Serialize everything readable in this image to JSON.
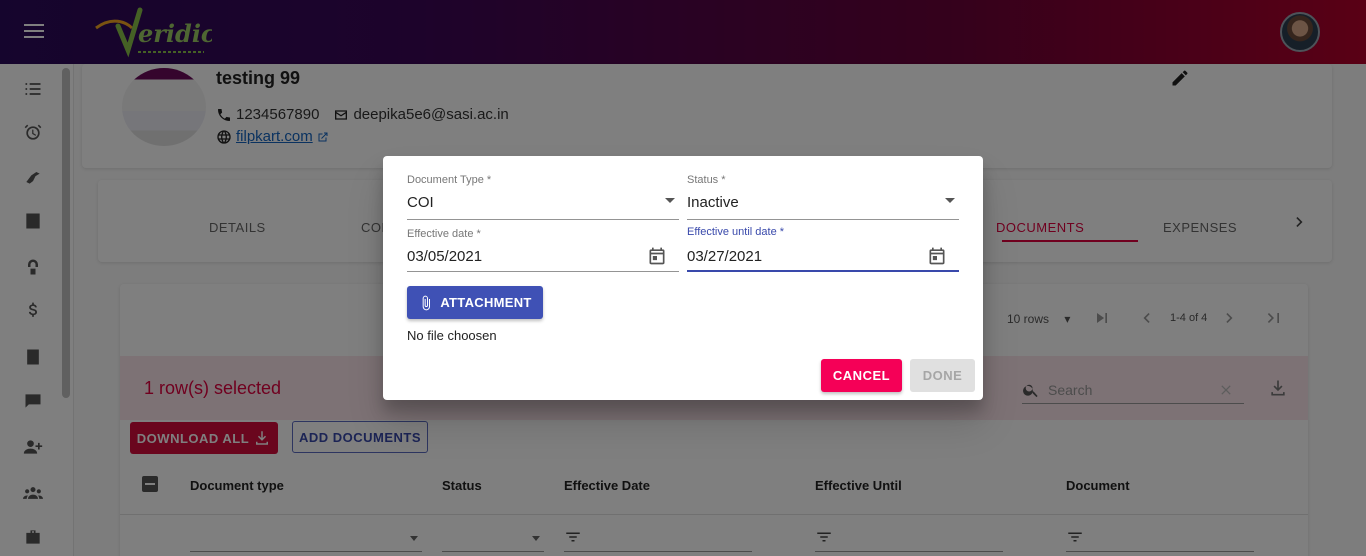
{
  "app": {
    "logo_text": "Veridic"
  },
  "profile": {
    "name": "testing 99",
    "phone": "1234567890",
    "email": "deepika5e6@sasi.ac.in",
    "website": "filpkart.com"
  },
  "tabs": {
    "details": "DETAILS",
    "partial": "CON",
    "documents": "DOCUMENTS",
    "expenses": "EXPENSES"
  },
  "table": {
    "rows_per_page": "10 rows",
    "page_range": "1-4 of 4",
    "selected_text": "1 row(s) selected",
    "search_placeholder": "Search",
    "download_all_label": "DOWNLOAD ALL",
    "add_documents_label": "ADD DOCUMENTS",
    "columns": [
      "Document type",
      "Status",
      "Effective Date",
      "Effective Until",
      "Document"
    ]
  },
  "dialog": {
    "document_type_label": "Document Type *",
    "document_type_value": "COI",
    "status_label": "Status *",
    "status_value": "Inactive",
    "effective_date_label": "Effective date *",
    "effective_date_value": "03/05/2021",
    "effective_until_label": "Effective until date *",
    "effective_until_value": "03/27/2021",
    "attachment_label": "ATTACHMENT",
    "file_status": "No file choosen",
    "cancel_label": "CANCEL",
    "done_label": "DONE"
  },
  "colors": {
    "accent": "#f50057",
    "primary": "#3f51b5",
    "selected_row_bg": "#fbe4ea"
  },
  "icons": {
    "menu": "menu-icon",
    "edit": "pencil-icon",
    "calendar": "calendar-icon",
    "attach": "paperclip-icon"
  }
}
